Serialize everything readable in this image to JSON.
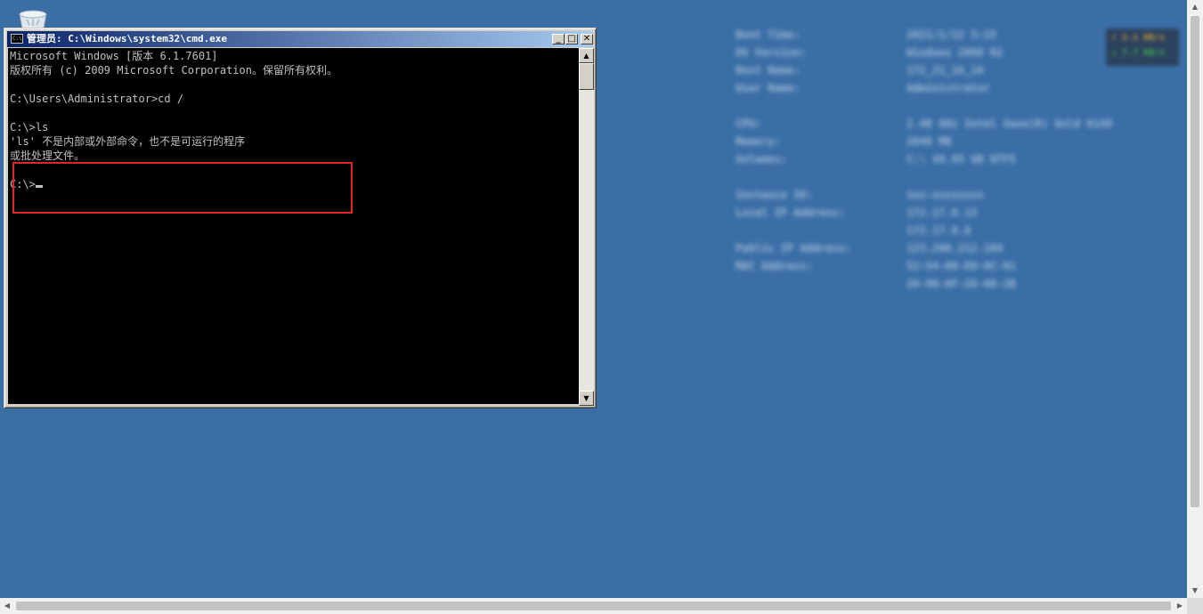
{
  "window": {
    "title": "管理员: C:\\Windows\\system32\\cmd.exe",
    "icon": "cmd-icon",
    "icon_text": "C:\\"
  },
  "titlebar_buttons": {
    "minimize": "_",
    "maximize": "□",
    "close": "✕"
  },
  "console": {
    "lines": [
      "Microsoft Windows [版本 6.1.7601]",
      "版权所有 (c) 2009 Microsoft Corporation。保留所有权利。",
      "",
      "C:\\Users\\Administrator>cd /",
      "",
      "C:\\>ls",
      "'ls' 不是内部或外部命令，也不是可运行的程序",
      "或批处理文件。",
      "",
      "C:\\>"
    ]
  },
  "colors": {
    "desktop": "#3a6ea5",
    "console_bg": "#000000",
    "console_fg": "#c0c0c0",
    "highlight": "#e0262a"
  },
  "bginfo": {
    "rows": [
      {
        "k": "Boot Time:",
        "v": "2021/1/12 5:15"
      },
      {
        "k": "OS Version:",
        "v": "Windows 2008 R2"
      },
      {
        "k": "Host Name:",
        "v": "172_21_16_16"
      },
      {
        "k": "User Name:",
        "v": "Administrator"
      },
      {
        "k": "",
        "v": ""
      },
      {
        "k": "CPU:",
        "v": "2.40 GHz Intel Xeon(R) Gold 6148"
      },
      {
        "k": "Memory:",
        "v": "2048 MB"
      },
      {
        "k": "Volumes:",
        "v": "C:\\ 49.95 GB NTFS"
      },
      {
        "k": "",
        "v": ""
      },
      {
        "k": "Instance ID:",
        "v": "ins-xxxxxxxx"
      },
      {
        "k": "Local IP Address:",
        "v": "172.17.0.13"
      },
      {
        "k": "",
        "v": "172.17.0.6"
      },
      {
        "k": "Public IP Address:",
        "v": "123.206.212.104"
      },
      {
        "k": "MAC Address:",
        "v": "52-54-00-E0-9C-91"
      },
      {
        "k": "",
        "v": "20-90-6F-28-68-2B"
      }
    ]
  },
  "net_meter": {
    "up": "↑ 2.1 KB/s",
    "down": "↓ 7.7 KB/s"
  }
}
